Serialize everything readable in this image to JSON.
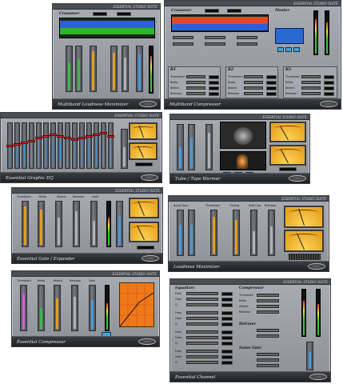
{
  "brand": "ESSENTIAL STUDIO SUITE",
  "panels": {
    "p1": {
      "title": "Multiband Loudness Maximizer",
      "crossover": "Crossover"
    },
    "p2": {
      "title": "Multiband Compressor",
      "crossover": "Crossover",
      "master": "Master",
      "bands": [
        "B1",
        "B2",
        "B3"
      ],
      "params": [
        "Threshold",
        "Ratio",
        "Attack",
        "Release"
      ]
    },
    "p3": {
      "title": "Essential Graphic EQ"
    },
    "p4": {
      "title": "Tube / Tape Warmer"
    },
    "p5": {
      "title": "Essential Gate / Expander",
      "params": [
        "Threshold",
        "Ratio",
        "Attack",
        "Release",
        "Hold"
      ]
    },
    "p6": {
      "title": "Loudness Maximizer",
      "params": [
        "Input Gain",
        "Threshold",
        "Ceiling",
        "Soft Clip",
        "Release"
      ]
    },
    "p7": {
      "title": "Essential Compressor",
      "params": [
        "Threshold",
        "Ratio",
        "Attack",
        "Release",
        "Gain"
      ]
    },
    "p8": {
      "title": "Essential Channel",
      "sections": [
        "Equalizer",
        "Compressor",
        "DeEsser",
        "Noise Gate"
      ],
      "eq_params": [
        "Freq",
        "Gain",
        "Q"
      ],
      "comp_params": [
        "Threshold",
        "Ratio",
        "Attack",
        "Release"
      ]
    }
  },
  "colors": {
    "accent": "#3aa9d6",
    "vu": "#f0b030",
    "panel": "#9ca0a6"
  }
}
